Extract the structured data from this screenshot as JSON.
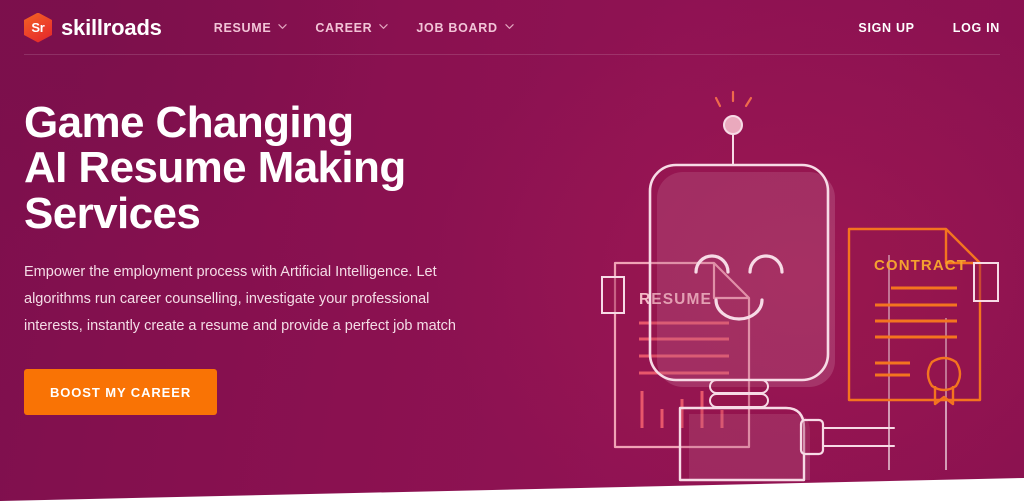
{
  "brand": {
    "mark_text": "Sr",
    "name": "skillroads",
    "mark_icon": "hexagon-logo-icon",
    "mark_color": "#ec3f2a"
  },
  "nav": {
    "items": [
      {
        "label": "RESUME",
        "caret_icon": "chevron-down-icon"
      },
      {
        "label": "CAREER",
        "caret_icon": "chevron-down-icon"
      },
      {
        "label": "JOB BOARD",
        "caret_icon": "chevron-down-icon"
      }
    ]
  },
  "header_right": {
    "sign_up": "SIGN UP",
    "log_in": "LOG IN"
  },
  "hero": {
    "title": "Game Changing\nAI Resume Making\nServices",
    "subtitle": "Empower the employment process with Artificial Intelligence. Let algorithms run career counselling, investigate your professional interests, instantly create a resume and provide a perfect job match",
    "cta_label": "BOOST MY CAREER",
    "cta_color": "#f97305"
  },
  "illustration": {
    "robot": {
      "name": "smiling-robot-icon",
      "antenna_icon": "antenna-bulb-icon",
      "face_icon": "smiling-face-icon",
      "stroke_color": "#f7dbe6"
    },
    "resume_document": {
      "title": "RESUME",
      "icon": "resume-document-icon",
      "stroke_color": "#f19fb4",
      "line_color": "#e8576b",
      "text_lines": 4,
      "chart_bars": 4
    },
    "contract_document": {
      "title": "CONTRACT",
      "icon": "contract-document-icon",
      "stroke_color": "#f4741f",
      "seal_icon": "award-seal-icon",
      "text_lines": 5
    }
  },
  "theme": {
    "background_left": "#7e0f4d",
    "background_right": "#8f1253",
    "foot_band": "#ffffff"
  }
}
